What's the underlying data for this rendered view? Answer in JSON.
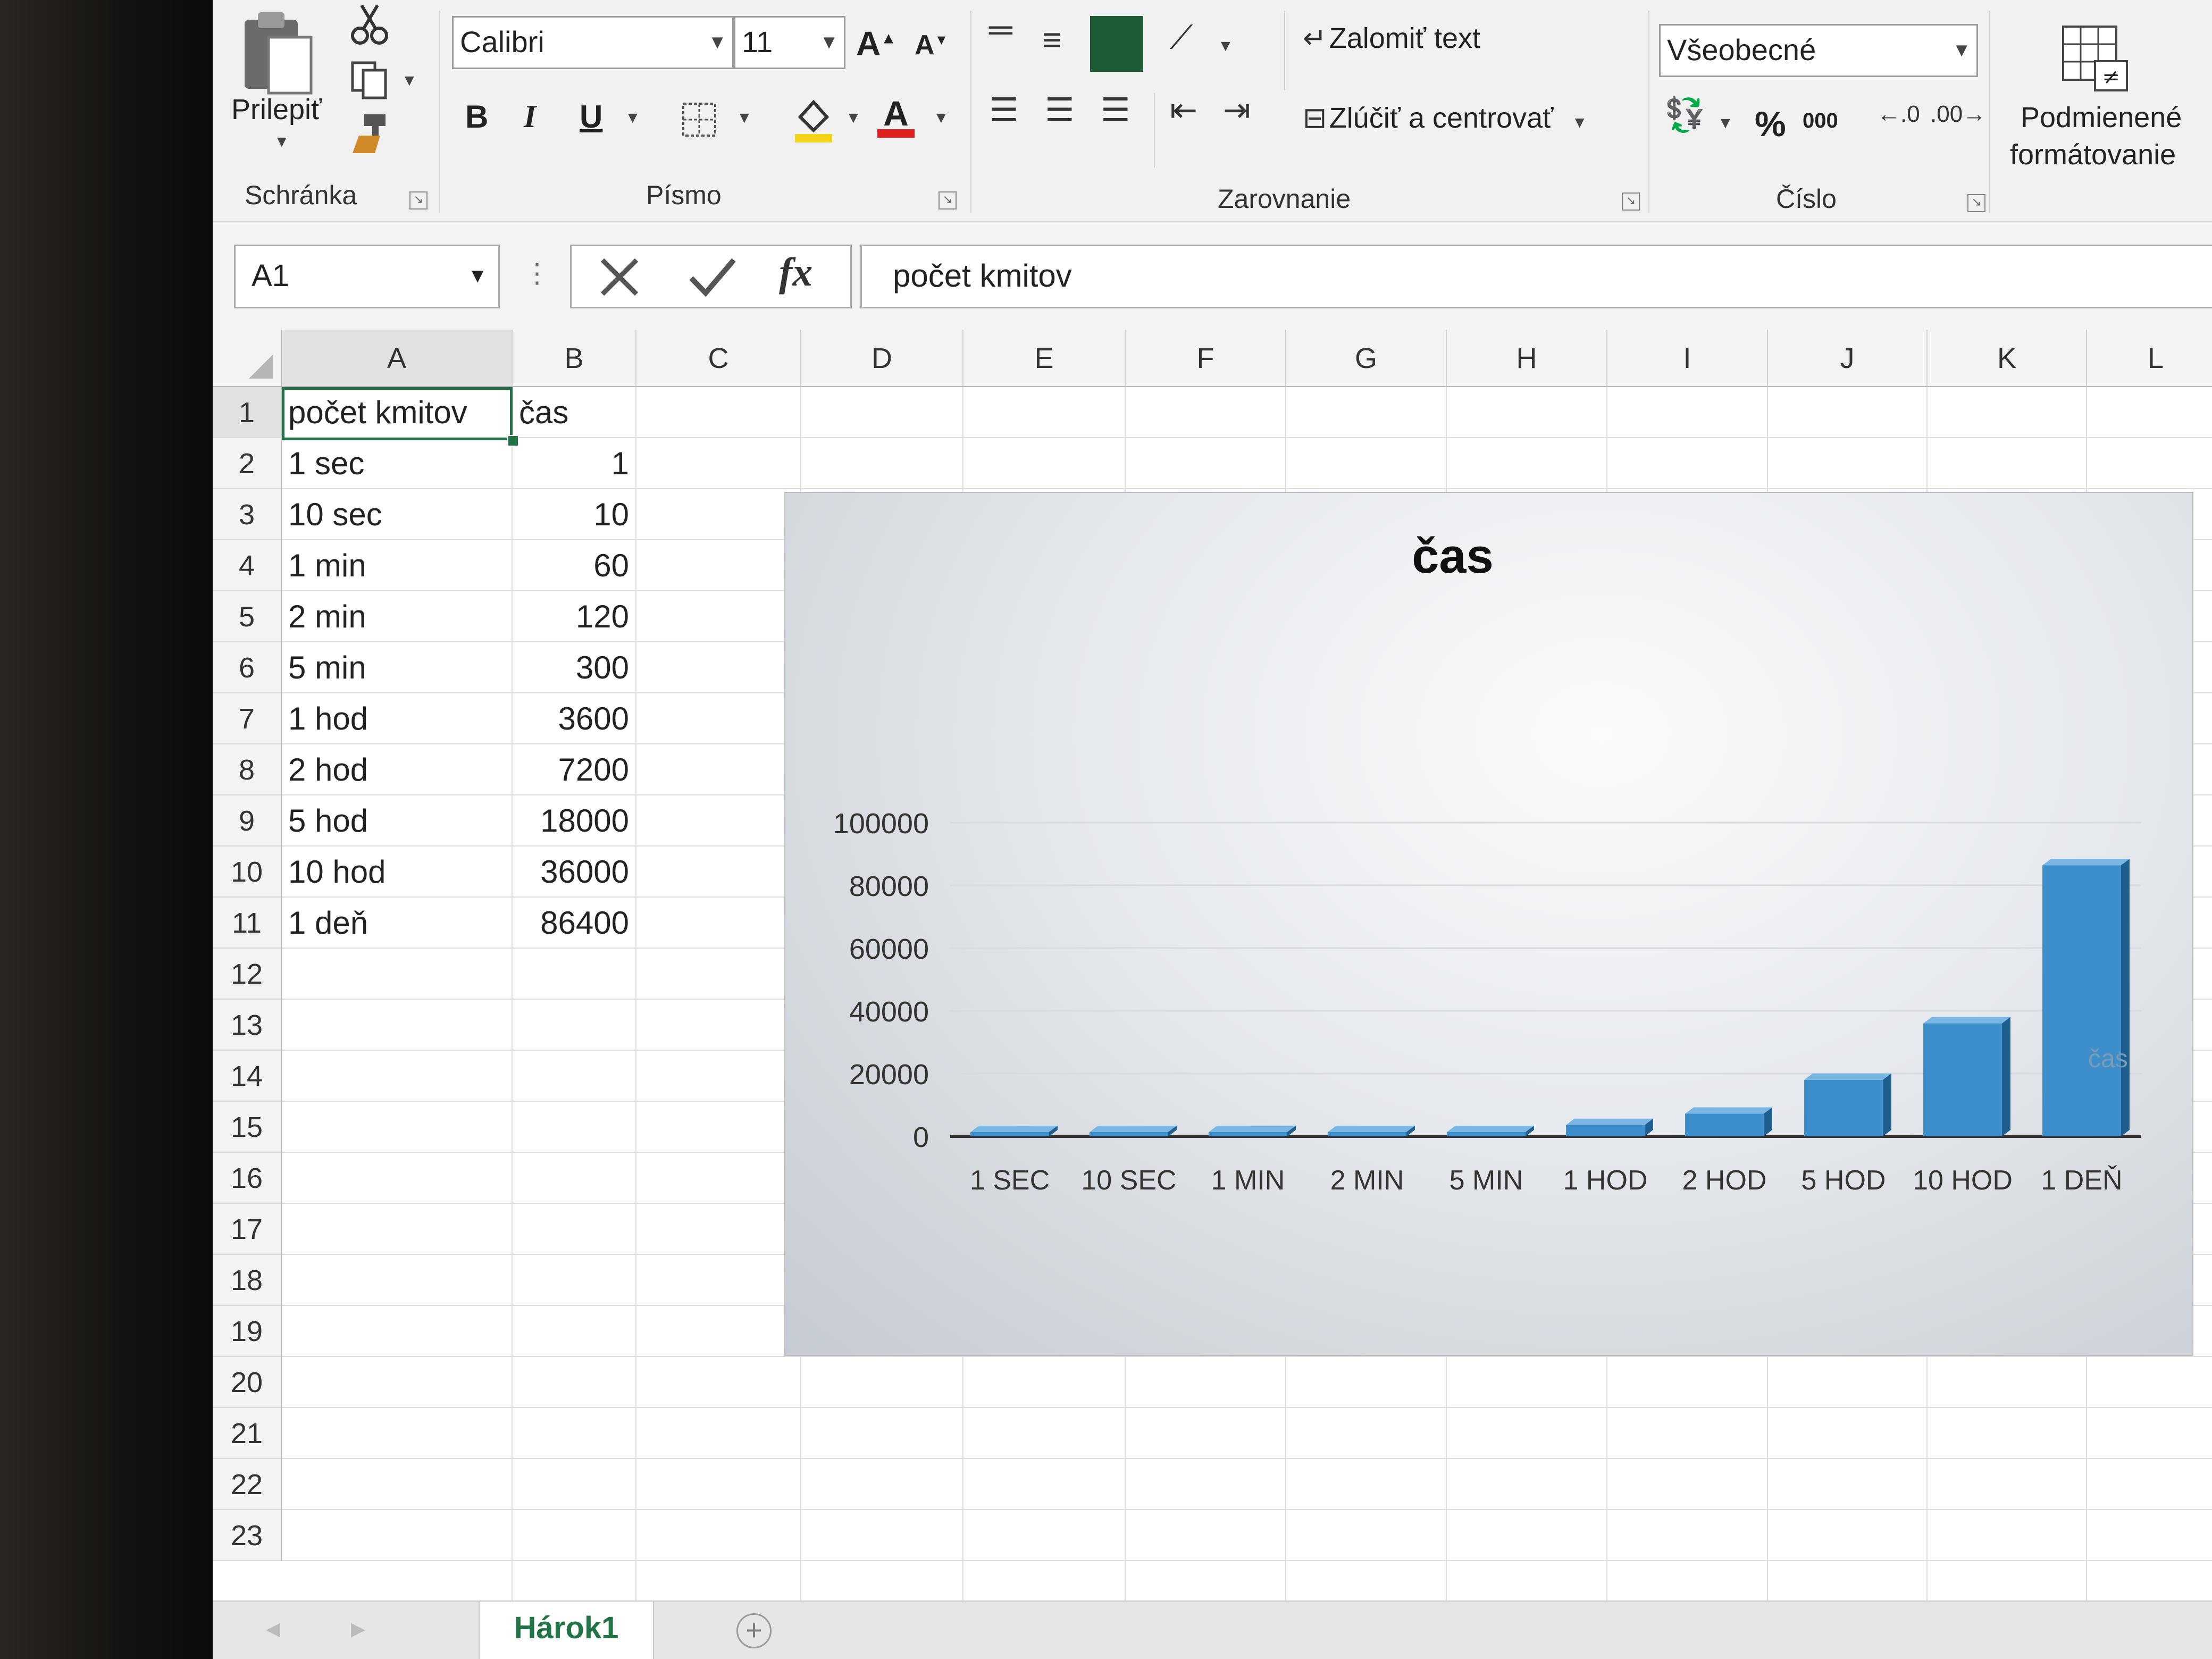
{
  "ribbon": {
    "clipboard": {
      "paste_label": "Prilepiť",
      "group_label": "Schránka"
    },
    "font": {
      "name": "Calibri",
      "size": "11",
      "bold": "B",
      "italic": "I",
      "underline": "U",
      "grow": "A",
      "shrink": "A",
      "color_letter": "A",
      "group_label": "Písmo"
    },
    "alignment": {
      "wrap_text": "Zalomiť text",
      "merge_center": "Zlúčiť a centrovať",
      "group_label": "Zarovnanie"
    },
    "number": {
      "format": "Všeobecné",
      "percent": "%",
      "thousands": "000",
      "group_label": "Číslo"
    },
    "styles": {
      "conditional_line1": "Podmienené",
      "conditional_line2": "formátovanie"
    }
  },
  "formula_bar": {
    "name_box": "A1",
    "fx": "fx",
    "content": "počet kmitov"
  },
  "sheet": {
    "columns": [
      "A",
      "B",
      "C",
      "D",
      "E",
      "F",
      "G",
      "H",
      "I",
      "J",
      "K",
      "L"
    ],
    "rows": [
      "1",
      "2",
      "3",
      "4",
      "5",
      "6",
      "7",
      "8",
      "9",
      "10",
      "11",
      "12",
      "13",
      "14",
      "15",
      "16",
      "17",
      "18",
      "19",
      "20",
      "21",
      "22",
      "23"
    ],
    "cells": [
      [
        "počet kmitov",
        "čas"
      ],
      [
        "1 sec",
        "1"
      ],
      [
        "10 sec",
        "10"
      ],
      [
        "1 min",
        "60"
      ],
      [
        "2 min",
        "120"
      ],
      [
        "5 min",
        "300"
      ],
      [
        "1 hod",
        "3600"
      ],
      [
        "2 hod",
        "7200"
      ],
      [
        "5 hod",
        "18000"
      ],
      [
        "10 hod",
        "36000"
      ],
      [
        "1 deň",
        "86400"
      ]
    ]
  },
  "chart_data": {
    "type": "bar",
    "title": "čas",
    "categories": [
      "1 SEC",
      "10 SEC",
      "1 MIN",
      "2 MIN",
      "5 MIN",
      "1 HOD",
      "2 HOD",
      "5 HOD",
      "10 HOD",
      "1 DEŇ"
    ],
    "series": [
      {
        "name": "čas",
        "values": [
          1,
          10,
          60,
          120,
          300,
          3600,
          7200,
          18000,
          36000,
          86400
        ],
        "color": "#3d8fcb"
      }
    ],
    "y_ticks": [
      "100000",
      "80000",
      "60000",
      "40000",
      "20000",
      "0"
    ],
    "ylim": [
      0,
      100000
    ],
    "xlabel": "",
    "ylabel": "",
    "grid": true,
    "legend": "right"
  },
  "tabs": {
    "sheet_name": "Hárok1",
    "add": "+"
  },
  "colors": {
    "excel_green": "#217346",
    "fill_dark_green": "#1e5c35",
    "font_color_red": "#e02020",
    "highlight_yellow": "#f4d31b"
  }
}
